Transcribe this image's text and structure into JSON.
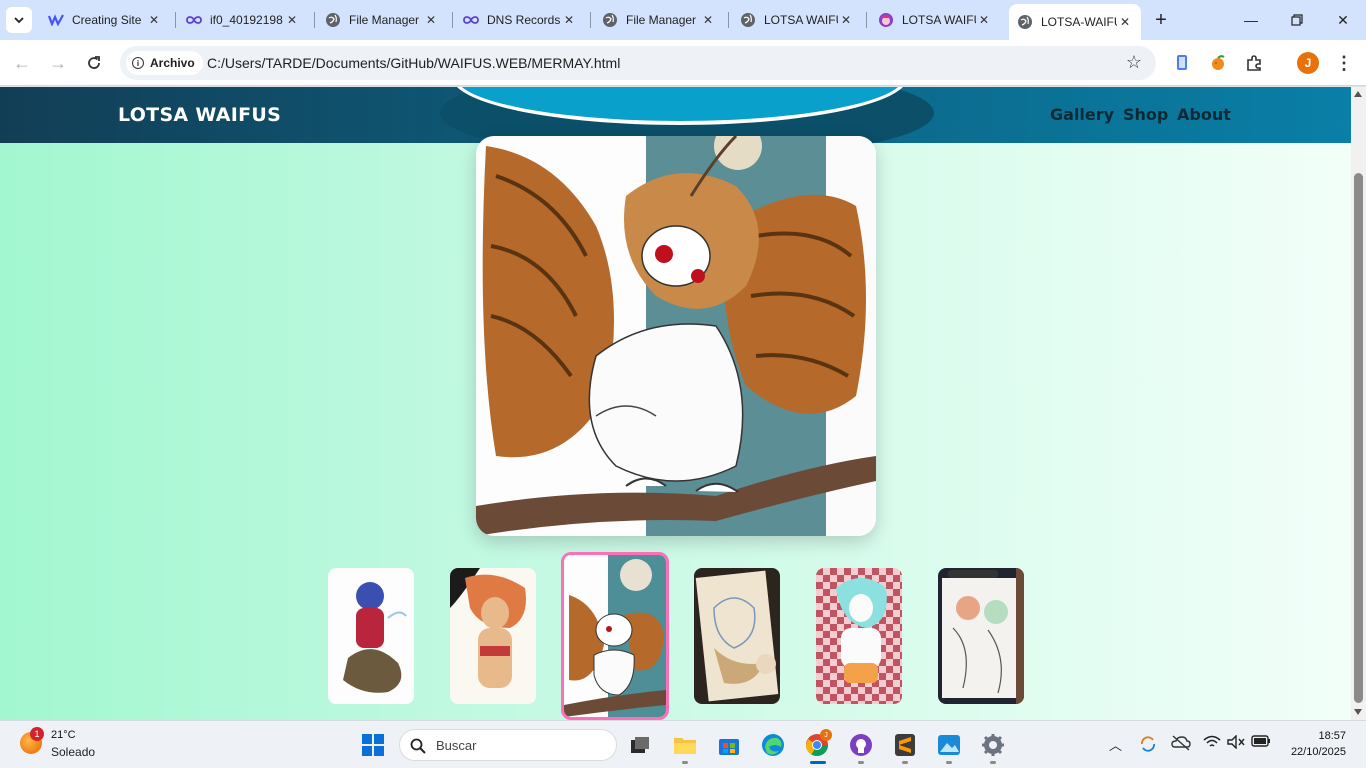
{
  "browser": {
    "tabs": [
      {
        "title": "Creating Site",
        "icon": "webflow-icon",
        "active": false
      },
      {
        "title": "if0_40192198",
        "icon": "infinityfree-icon",
        "active": false
      },
      {
        "title": "File Manager",
        "icon": "globe-icon",
        "active": false
      },
      {
        "title": "DNS Records",
        "icon": "infinityfree-icon",
        "active": false
      },
      {
        "title": "File Manager",
        "icon": "globe-icon",
        "active": false
      },
      {
        "title": "LOTSA WAIFUS",
        "icon": "globe-icon",
        "active": false
      },
      {
        "title": "LOTSA WAIFUS",
        "icon": "anime-avatar-icon",
        "active": false
      },
      {
        "title": "LOTSA-WAIFUS",
        "icon": "globe-icon",
        "active": true
      }
    ],
    "address": {
      "security_chip": "Archivo",
      "url": "C:/Users/TARDE/Documents/GitHub/WAIFUS.WEB/MERMAY.html"
    },
    "profile_initial": "J"
  },
  "site": {
    "logo": "LOTSA WAIFUS",
    "nav": [
      "Gallery",
      "Shop",
      "About"
    ],
    "gallery": {
      "selected_index": 2,
      "thumbnails": [
        {
          "name": "thumb-mermaid-red-hoodie",
          "palette": [
            "#fdfdfd",
            "#b8253d",
            "#6b5a3e",
            "#3a4fb0"
          ]
        },
        {
          "name": "thumb-orange-hair-girl",
          "palette": [
            "#fbf8f2",
            "#e07a45",
            "#c43a3a",
            "#e8b98a"
          ]
        },
        {
          "name": "thumb-owl-harpy",
          "palette": [
            "#fdfdfd",
            "#b5692a",
            "#4e8e96",
            "#e8e1d2"
          ]
        },
        {
          "name": "thumb-sketchbook-mermaid",
          "palette": [
            "#2c241f",
            "#efe4cf",
            "#caa877",
            "#7a97b8"
          ]
        },
        {
          "name": "thumb-teal-hair-girl-checkered",
          "palette": [
            "#f4cdd2",
            "#bf5561",
            "#8ce0e0",
            "#f3a24a"
          ]
        },
        {
          "name": "thumb-sketchbook-lineart",
          "palette": [
            "#1f2430",
            "#f4f2ee",
            "#b6dcc2",
            "#e7a585"
          ]
        }
      ]
    }
  },
  "taskbar": {
    "weather": {
      "temp": "21°C",
      "condition": "Soleado",
      "badge": "1"
    },
    "search_placeholder": "Buscar",
    "apps": [
      "task-view-icon",
      "file-explorer-icon",
      "microsoft-store-icon",
      "edge-icon",
      "chrome-icon",
      "github-desktop-icon",
      "sublime-text-icon",
      "photos-icon",
      "settings-icon"
    ],
    "clock": {
      "time": "18:57",
      "date": "22/10/2025"
    }
  }
}
